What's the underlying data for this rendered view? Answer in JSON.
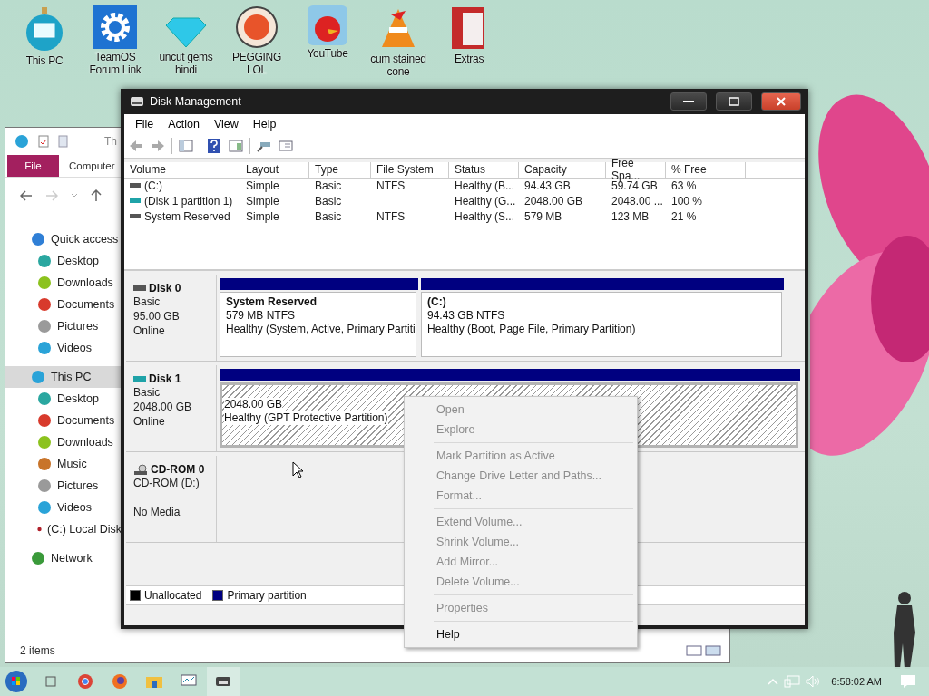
{
  "desktop_icons": [
    {
      "label": "This PC",
      "kind": "pc"
    },
    {
      "label": "TeamOS Forum Link",
      "kind": "gear"
    },
    {
      "label": "uncut gems hindi",
      "kind": "gem"
    },
    {
      "label": "PEGGING LOL",
      "kind": "letter"
    },
    {
      "label": "YouTube",
      "kind": "bird"
    },
    {
      "label": "cum stained cone",
      "kind": "cone"
    },
    {
      "label": "Extras",
      "kind": "folder"
    }
  ],
  "explorer": {
    "title": "Th",
    "tabs": [
      {
        "label": "File",
        "selected": true
      },
      {
        "label": "Computer",
        "selected": false
      }
    ],
    "nav": [
      {
        "label": "Quick access",
        "selected": false,
        "color": "#2f7fd6",
        "children": [
          {
            "label": "Desktop",
            "selected": false,
            "color": "#2aa7a0"
          },
          {
            "label": "Downloads",
            "selected": false,
            "color": "#8cc21e"
          },
          {
            "label": "Documents",
            "selected": false,
            "color": "#d83a2c"
          },
          {
            "label": "Pictures",
            "selected": false,
            "color": "#9a9a9a"
          },
          {
            "label": "Videos",
            "selected": false,
            "color": "#2aa3d8"
          }
        ]
      },
      {
        "label": "This PC",
        "selected": true,
        "color": "#2aa3d8",
        "children": [
          {
            "label": "Desktop",
            "selected": false,
            "color": "#2aa7a0"
          },
          {
            "label": "Documents",
            "selected": false,
            "color": "#d83a2c"
          },
          {
            "label": "Downloads",
            "selected": false,
            "color": "#8cc21e"
          },
          {
            "label": "Music",
            "selected": false,
            "color": "#c8742a"
          },
          {
            "label": "Pictures",
            "selected": false,
            "color": "#9a9a9a"
          },
          {
            "label": "Videos",
            "selected": false,
            "color": "#2aa3d8"
          },
          {
            "label": "(C:) Local Disk",
            "selected": false,
            "color": "#b0202a"
          }
        ]
      },
      {
        "label": "Network",
        "selected": false,
        "color": "#3a9a3a"
      }
    ],
    "status": "2 items"
  },
  "disk_management": {
    "title": "Disk Management",
    "menu": [
      "File",
      "Action",
      "View",
      "Help"
    ],
    "columns": [
      "Volume",
      "Layout",
      "Type",
      "File System",
      "Status",
      "Capacity",
      "Free Spa...",
      "% Free"
    ],
    "rows": [
      {
        "cells": [
          "(C:)",
          "Simple",
          "Basic",
          "NTFS",
          "Healthy (B...",
          "94.43 GB",
          "59.74 GB",
          "63 %"
        ],
        "color": "#555555"
      },
      {
        "cells": [
          "(Disk 1 partition 1)",
          "Simple",
          "Basic",
          "",
          "Healthy (G...",
          "2048.00 GB",
          "2048.00 ...",
          "100 %"
        ],
        "color": "#1fa3a8"
      },
      {
        "cells": [
          "System Reserved",
          "Simple",
          "Basic",
          "NTFS",
          "Healthy (S...",
          "579 MB",
          "123 MB",
          "21 %"
        ],
        "color": "#555555"
      }
    ],
    "disks": [
      {
        "name": "Disk 0",
        "kind": "hdd",
        "type": "Basic",
        "size": "95.00 GB",
        "status": "Online",
        "partitions": [
          {
            "title": "System Reserved",
            "size": "579 MB NTFS",
            "status": "Healthy (System, Active, Primary Partiti",
            "selected": false
          },
          {
            "title": "(C:)",
            "size": "94.43 GB NTFS",
            "status": "Healthy (Boot, Page File, Primary Partition)",
            "selected": false
          }
        ]
      },
      {
        "name": "Disk 1",
        "kind": "hdd",
        "type": "Basic",
        "size": "2048.00 GB",
        "status": "Online",
        "partitions": [
          {
            "size": "2048.00 GB",
            "status": "Healthy (GPT Protective Partition)",
            "selected": true
          }
        ]
      },
      {
        "name": "CD-ROM 0",
        "kind": "cdrom",
        "type": "CD-ROM (D:)",
        "status": "No Media"
      }
    ],
    "legend": [
      {
        "label": "Unallocated",
        "color": "#000000"
      },
      {
        "label": "Primary partition",
        "color": "#000080"
      }
    ]
  },
  "context_menu": [
    [
      {
        "label": "Open",
        "disabled": true
      },
      {
        "label": "Explore",
        "disabled": true
      }
    ],
    [
      {
        "label": "Mark Partition as Active",
        "disabled": true
      },
      {
        "label": "Change Drive Letter and Paths...",
        "disabled": true
      },
      {
        "label": "Format...",
        "disabled": true
      }
    ],
    [
      {
        "label": "Extend Volume...",
        "disabled": true
      },
      {
        "label": "Shrink Volume...",
        "disabled": true
      },
      {
        "label": "Add Mirror...",
        "disabled": true
      },
      {
        "label": "Delete Volume...",
        "disabled": true
      }
    ],
    [
      {
        "label": "Properties",
        "disabled": true
      }
    ],
    [
      {
        "label": "Help",
        "disabled": false
      }
    ]
  ],
  "taskbar": {
    "clock": "6:58:02 AM"
  }
}
